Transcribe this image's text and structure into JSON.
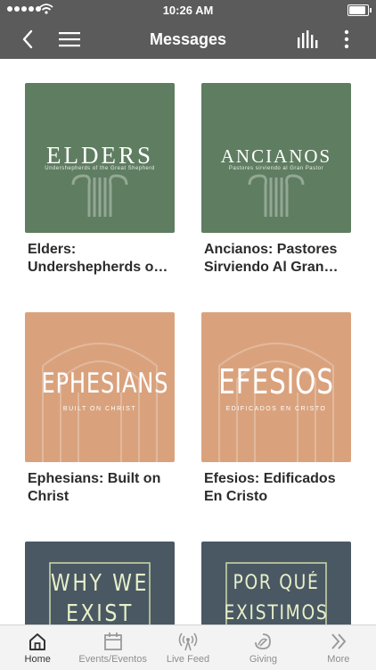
{
  "status": {
    "time": "10:26 AM"
  },
  "nav": {
    "title": "Messages"
  },
  "icons": {
    "back": "chevron-left-icon",
    "menu": "hamburger-menu-icon",
    "equalizer": "equalizer-icon",
    "more": "vertical-dots-icon"
  },
  "cards": [
    {
      "label": "Elders: Undershepherds o…",
      "art_title": "ELDERS",
      "art_subtitle": "Undershepherds of the Great Shepherd",
      "theme": "green"
    },
    {
      "label": "Ancianos: Pastores Sirviendo Al Gran…",
      "art_title": "ANCIANOS",
      "art_subtitle": "Pastores sirviendo al Gran Pastor",
      "theme": "green"
    },
    {
      "label": "Ephesians: Built on Christ",
      "art_title": "EPHESIANS",
      "art_subtitle": "BUILT ON CHRIST",
      "theme": "tan"
    },
    {
      "label": "Efesios: Edificados En Cristo",
      "art_title": "EFESIOS",
      "art_subtitle": "EDIFICADOS EN CRISTO",
      "theme": "tan"
    },
    {
      "label": "",
      "art_title": "WHY WE\nEXIST",
      "art_subtitle": "",
      "theme": "slate"
    },
    {
      "label": "",
      "art_title": "POR QUÉ\nEXISTIMOS",
      "art_subtitle": "",
      "theme": "slate"
    }
  ],
  "tabs": [
    {
      "label": "Home",
      "icon": "home-icon",
      "active": true
    },
    {
      "label": "Events/Eventos",
      "icon": "calendar-icon",
      "active": false
    },
    {
      "label": "Live Feed",
      "icon": "broadcast-icon",
      "active": false
    },
    {
      "label": "Giving",
      "icon": "giving-icon",
      "active": false
    },
    {
      "label": "More",
      "icon": "double-chevron-right-icon",
      "active": false
    }
  ],
  "colors": {
    "bar": "#5b5b5b",
    "green_art": "#5f7d61",
    "tan_art": "#d9a27d",
    "slate_art": "#4a5864"
  }
}
